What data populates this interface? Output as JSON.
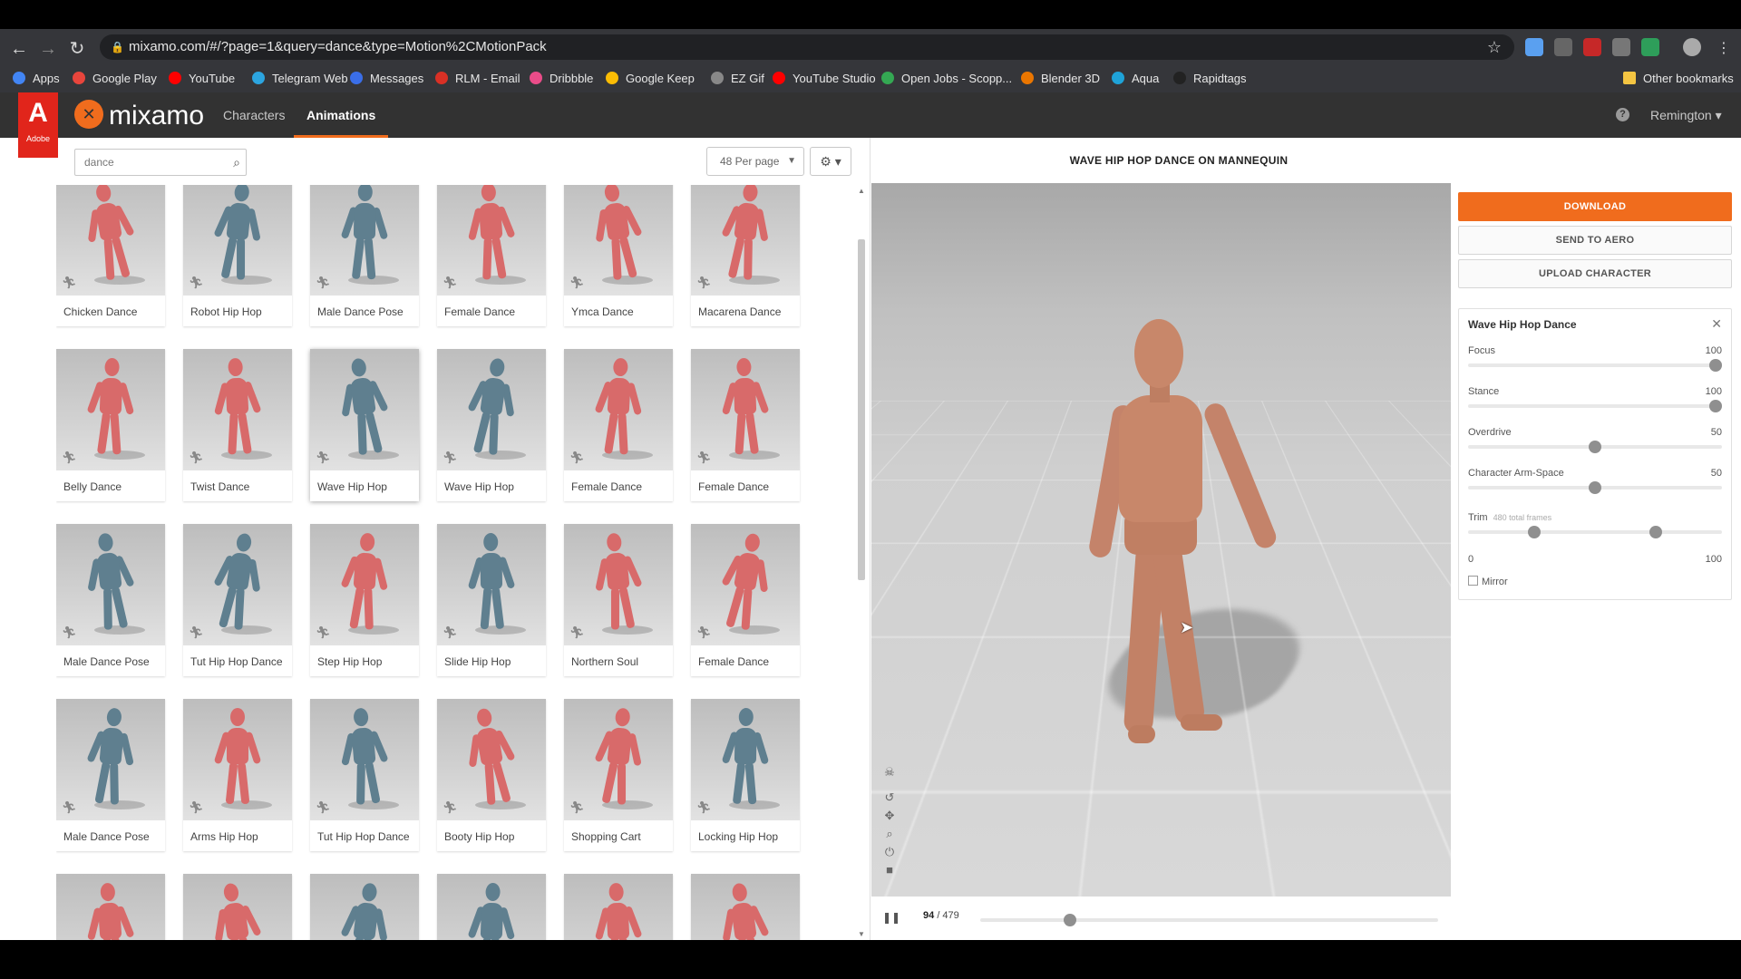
{
  "browser": {
    "url": "mixamo.com/#/?page=1&query=dance&type=Motion%2CMotionPack",
    "bookmarks": [
      {
        "label": "Apps",
        "color": "#4285f4"
      },
      {
        "label": "Google Play",
        "color": "#e8453c"
      },
      {
        "label": "YouTube",
        "color": "#ff0000"
      },
      {
        "label": "Telegram Web",
        "color": "#2ca5e0"
      },
      {
        "label": "Messages",
        "color": "#3a6ee8"
      },
      {
        "label": "RLM - Email",
        "color": "#d93025"
      },
      {
        "label": "Dribbble",
        "color": "#ea4c89"
      },
      {
        "label": "Google Keep",
        "color": "#fbbc04"
      },
      {
        "label": "EZ Gif",
        "color": "#888888"
      },
      {
        "label": "YouTube Studio",
        "color": "#ff0000"
      },
      {
        "label": "Open Jobs - Scopp...",
        "color": "#34a853"
      },
      {
        "label": "Blender 3D",
        "color": "#ea7600"
      },
      {
        "label": "Aqua",
        "color": "#1fa3d8"
      },
      {
        "label": "Rapidtags",
        "color": "#222222"
      }
    ],
    "other_bookmarks": "Other bookmarks"
  },
  "header": {
    "adobe_letter": "A",
    "adobe_text": "Adobe",
    "logo": "mixamo",
    "tabs": [
      {
        "label": "Characters",
        "active": false
      },
      {
        "label": "Animations",
        "active": true
      }
    ],
    "help": "?",
    "user": "Remington ▾"
  },
  "toolbar": {
    "search_value": "dance",
    "per_page": "48 Per page"
  },
  "animations": [
    {
      "label": "Chicken Dance",
      "tone": "red"
    },
    {
      "label": "Robot Hip Hop",
      "tone": "blue"
    },
    {
      "label": "Male Dance Pose",
      "tone": "blue"
    },
    {
      "label": "Female Dance",
      "tone": "red"
    },
    {
      "label": "Ymca Dance",
      "tone": "red"
    },
    {
      "label": "Macarena Dance",
      "tone": "red"
    },
    {
      "label": "Belly Dance",
      "tone": "red"
    },
    {
      "label": "Twist Dance",
      "tone": "red"
    },
    {
      "label": "Wave Hip Hop",
      "tone": "blue",
      "selected": true
    },
    {
      "label": "Wave Hip Hop",
      "tone": "blue"
    },
    {
      "label": "Female Dance",
      "tone": "red"
    },
    {
      "label": "Female Dance",
      "tone": "red"
    },
    {
      "label": "Male Dance Pose",
      "tone": "blue"
    },
    {
      "label": "Tut Hip Hop Dance",
      "tone": "blue"
    },
    {
      "label": "Step Hip Hop",
      "tone": "red"
    },
    {
      "label": "Slide Hip Hop",
      "tone": "blue"
    },
    {
      "label": "Northern Soul",
      "tone": "red"
    },
    {
      "label": "Female Dance",
      "tone": "red"
    },
    {
      "label": "Male Dance Pose",
      "tone": "blue"
    },
    {
      "label": "Arms Hip Hop",
      "tone": "red"
    },
    {
      "label": "Tut Hip Hop Dance",
      "tone": "blue"
    },
    {
      "label": "Booty Hip Hop",
      "tone": "red"
    },
    {
      "label": "Shopping Cart",
      "tone": "red"
    },
    {
      "label": "Locking Hip Hop",
      "tone": "blue"
    },
    {
      "label": "",
      "tone": "red"
    },
    {
      "label": "",
      "tone": "red"
    },
    {
      "label": "",
      "tone": "blue"
    },
    {
      "label": "",
      "tone": "blue"
    },
    {
      "label": "",
      "tone": "red"
    },
    {
      "label": "",
      "tone": "red"
    }
  ],
  "tones": {
    "red": "#d86a6a",
    "blue": "#5f7f8f"
  },
  "viewer": {
    "title": "WAVE HIP HOP DANCE ON MANNEQUIN",
    "frame_current": "94",
    "frame_total": "/ 479",
    "progress": 0.196
  },
  "side": {
    "download": "DOWNLOAD",
    "send_to_aero": "SEND TO AERO",
    "upload_character": "UPLOAD CHARACTER",
    "panel_title": "Wave Hip Hop Dance",
    "sliders": [
      {
        "name": "Focus",
        "value": "100",
        "level": 1.0
      },
      {
        "name": "Stance",
        "value": "100",
        "level": 1.0
      },
      {
        "name": "Overdrive",
        "value": "50",
        "level": 0.5
      },
      {
        "name": "Character Arm-Space",
        "value": "50",
        "level": 0.5
      }
    ],
    "trim": {
      "name": "Trim",
      "sub": "480 total frames",
      "min_label": "0",
      "max_label": "100",
      "start": 0.26,
      "end": 0.74
    },
    "mirror": "Mirror"
  },
  "colors": {
    "accent": "#f06c1d",
    "adobe_red": "#e1251b"
  }
}
